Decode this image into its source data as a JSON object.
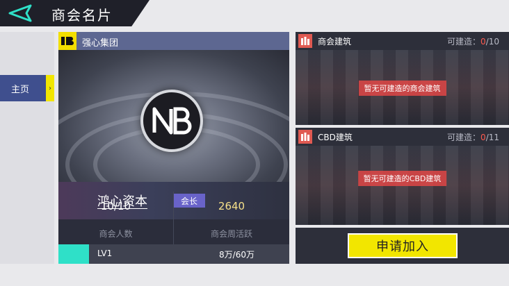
{
  "header": {
    "title": "商会名片"
  },
  "nav": {
    "home_label": "主页",
    "home_tab_glyph": "›"
  },
  "card": {
    "group_name": "强心集团",
    "org_name": "鸿心资本",
    "role_badge": "会长",
    "stats": {
      "members_value": "10/10",
      "members_label": "商会人数",
      "activity_value": "2640",
      "activity_label": "商会周活跃"
    },
    "level": {
      "label": "LV1",
      "value": "8万/60万",
      "progress": 0.133
    }
  },
  "panels": {
    "chamber_buildings": {
      "title": "商会建筑",
      "count_prefix": "可建造：",
      "count_current": "0",
      "count_total": "/10",
      "notice": "暂无可建造的商会建筑"
    },
    "cbd_buildings": {
      "title": "CBD建筑",
      "count_prefix": "可建造：",
      "count_current": "0",
      "count_total": "/11",
      "notice": "暂无可建造的CBD建筑"
    }
  },
  "join_button": {
    "label": "申请加入"
  },
  "colors": {
    "accent_yellow": "#f2e600",
    "teal": "#2fe0c8",
    "red_count": "#ff5a4f",
    "role_badge": "#6963c9"
  }
}
